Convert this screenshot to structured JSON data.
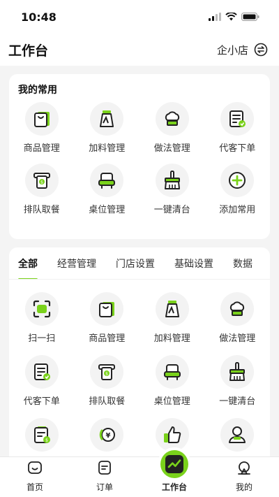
{
  "status": {
    "time": "10:48"
  },
  "header": {
    "title": "工作台",
    "store_name": "企小店"
  },
  "favorites": {
    "title": "我的常用",
    "items": [
      {
        "label": "商品管理",
        "icon": "bag-icon"
      },
      {
        "label": "加料管理",
        "icon": "cup-icon"
      },
      {
        "label": "做法管理",
        "icon": "chef-hat-icon"
      },
      {
        "label": "代客下单",
        "icon": "order-list-icon"
      },
      {
        "label": "排队取餐",
        "icon": "ticket-icon"
      },
      {
        "label": "桌位管理",
        "icon": "seat-icon"
      },
      {
        "label": "一键清台",
        "icon": "broom-icon"
      },
      {
        "label": "添加常用",
        "icon": "add-icon"
      }
    ]
  },
  "all": {
    "tabs": [
      {
        "label": "全部",
        "active": true
      },
      {
        "label": "经营管理"
      },
      {
        "label": "门店设置"
      },
      {
        "label": "基础设置"
      },
      {
        "label": "数据"
      }
    ],
    "items": [
      {
        "label": "扫一扫",
        "icon": "scan-icon"
      },
      {
        "label": "商品管理",
        "icon": "bag-icon"
      },
      {
        "label": "加料管理",
        "icon": "cup-icon"
      },
      {
        "label": "做法管理",
        "icon": "chef-hat-icon"
      },
      {
        "label": "代客下单",
        "icon": "order-list-icon"
      },
      {
        "label": "排队取餐",
        "icon": "ticket-icon"
      },
      {
        "label": "桌位管理",
        "icon": "seat-icon"
      },
      {
        "label": "一键清台",
        "icon": "broom-icon"
      },
      {
        "label": "",
        "icon": "bill-icon"
      },
      {
        "label": "",
        "icon": "refund-icon"
      },
      {
        "label": "",
        "icon": "thumbs-up-icon"
      },
      {
        "label": "",
        "icon": "user-icon"
      }
    ]
  },
  "tabbar": {
    "items": [
      {
        "label": "首页",
        "icon": "home-icon"
      },
      {
        "label": "订单",
        "icon": "order-icon"
      },
      {
        "label": "工作台",
        "icon": "workbench-icon",
        "active": true
      },
      {
        "label": "我的",
        "icon": "profile-icon"
      }
    ]
  },
  "colors": {
    "accent": "#7ad21b",
    "ink": "#222222",
    "background": "#f4f4f4"
  }
}
